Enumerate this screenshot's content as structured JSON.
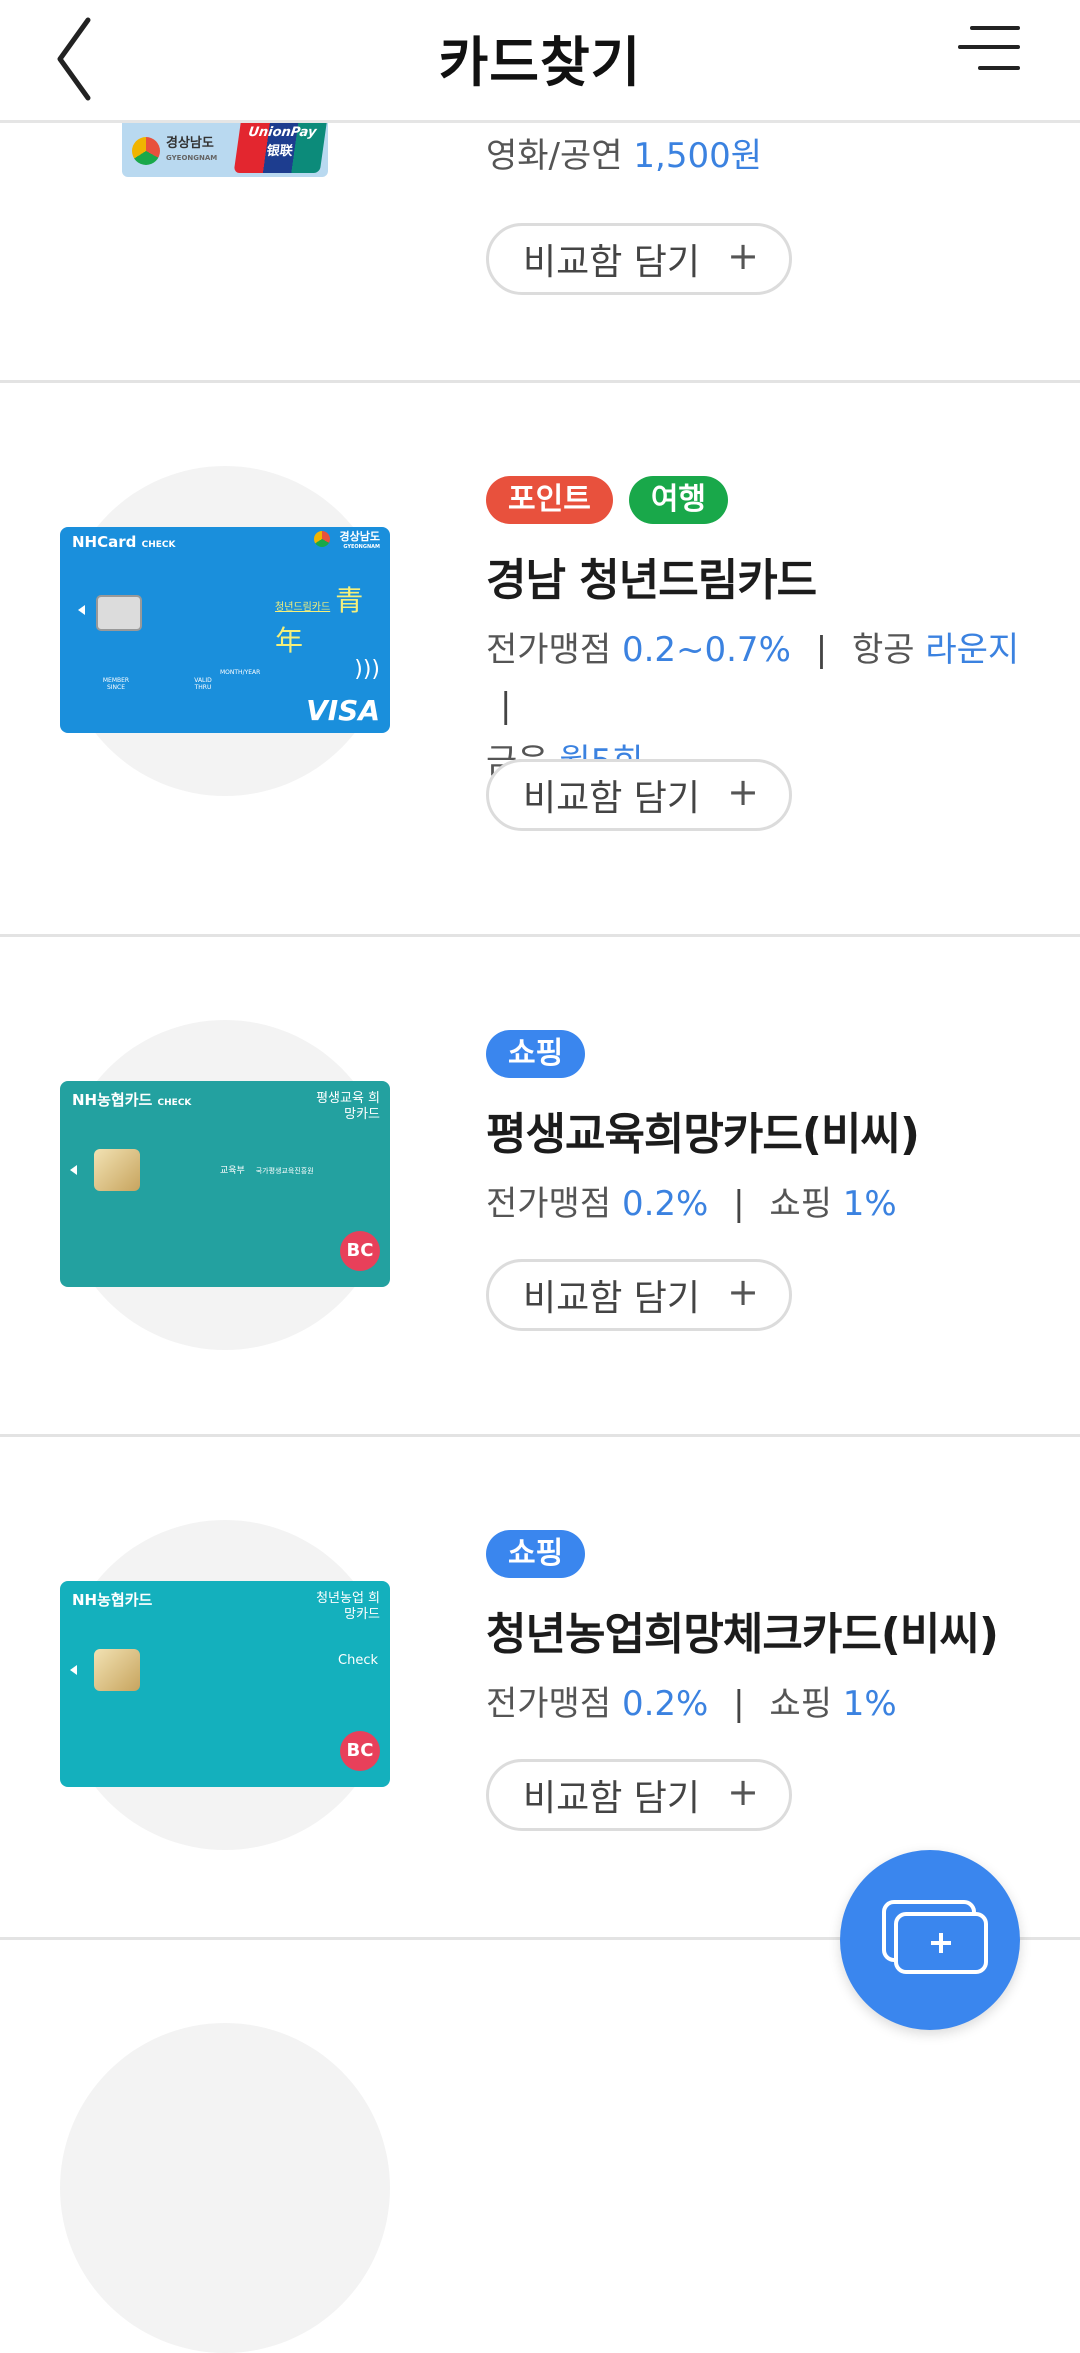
{
  "header": {
    "title": "카드찾기",
    "back_icon": "chevron-left-icon",
    "menu_icon": "hamburger-menu-icon"
  },
  "compare_button_label": "비교함 담기",
  "compare_button_plus": "+",
  "top_partial": {
    "benefit_label": "영화/공연",
    "benefit_value": "1,500원",
    "card_logo_text": "경상남도",
    "card_logo_sub": "GYEONGNAM",
    "card_network": "UnionPay",
    "card_network_sub": "银联"
  },
  "cards": [
    {
      "tags": [
        {
          "label": "포인트",
          "color": "#e8513d"
        },
        {
          "label": "여행",
          "color": "#19a84a"
        }
      ],
      "name": "경남 청년드림카드",
      "benefits_line1": [
        {
          "label": "전가맹점",
          "value": "0.2~0.7%"
        },
        {
          "label": "항공",
          "value": "라운지"
        }
      ],
      "benefits_line2": [
        {
          "label": "금융",
          "value": "월5회"
        }
      ],
      "card_image": {
        "brand": "NHCard",
        "brand_sub": "CHECK",
        "region": "경상남도",
        "region_sub": "GYEONGNAM",
        "product": "청년드림카드",
        "product_hanja": "青年",
        "network": "VISA",
        "field1": "MEMBER SINCE",
        "field2": "VALID THRU",
        "field3": "MONTH/YEAR",
        "color": "#1a8fdc"
      }
    },
    {
      "tags": [
        {
          "label": "쇼핑",
          "color": "#3a86ee"
        }
      ],
      "name": "평생교육희망카드(비씨)",
      "benefits_line1": [
        {
          "label": "전가맹점",
          "value": "0.2%"
        },
        {
          "label": "쇼핑",
          "value": "1%"
        }
      ],
      "benefits_line2": [],
      "card_image": {
        "brand": "NH농협카드",
        "brand_sub": "CHECK",
        "product": "평생교육 희망카드",
        "issuer": "교육부",
        "issuer2": "국가평생교육진흥원",
        "network": "BC",
        "color": "#23a1a0"
      }
    },
    {
      "tags": [
        {
          "label": "쇼핑",
          "color": "#3a86ee"
        }
      ],
      "name": "청년농업희망체크카드(비씨)",
      "benefits_line1": [
        {
          "label": "전가맹점",
          "value": "0.2%"
        },
        {
          "label": "쇼핑",
          "value": "1%"
        }
      ],
      "benefits_line2": [],
      "card_image": {
        "brand": "NH농협카드",
        "product": "청년농업 희망카드",
        "type": "Check",
        "network": "BC",
        "color": "#14b0bd"
      }
    }
  ],
  "fab": {
    "icon": "add-to-compare-icon"
  }
}
